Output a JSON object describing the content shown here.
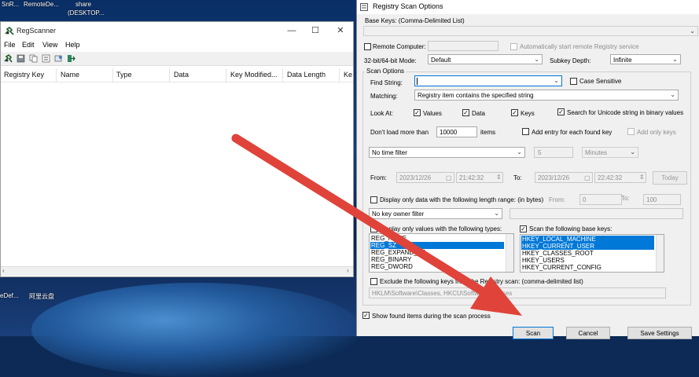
{
  "desktop": {
    "top_labels": [
      "SnR...",
      "RemoteDe...",
      "share",
      "(DESKTOP..."
    ],
    "bottom_labels": [
      "eDef...",
      "阿里云盘"
    ]
  },
  "regscanner": {
    "title": "RegScanner",
    "menu": [
      "File",
      "Edit",
      "View",
      "Help"
    ],
    "columns": [
      "Registry Key",
      "Name",
      "Type",
      "Data",
      "Key Modified...",
      "Data Length",
      "Ke"
    ],
    "toolbar_icons": [
      "regscanner-icon",
      "save-icon",
      "copy-icon",
      "properties-icon",
      "refresh-icon",
      "exit-icon"
    ]
  },
  "dialog": {
    "title": "Registry Scan Options",
    "base_keys_label": "Base Keys:  (Comma-Delimited List)",
    "base_keys_value": "",
    "remote_computer_label": "Remote Computer:",
    "remote_computer_value": "",
    "auto_start_label": "Automatically start remote Registry service",
    "mode_label": "32-bit/64-bit Mode:",
    "mode_value": "Default",
    "subkey_depth_label": "Subkey Depth:",
    "subkey_depth_value": "Infinite",
    "scan_options_label": "Scan Options",
    "find_string_label": "Find String:",
    "find_string_value": "",
    "case_sensitive_label": "Case Sensitive",
    "matching_label": "Matching:",
    "matching_value": "Registry item contains the specified string",
    "look_at_label": "Look At:",
    "values_label": "Values",
    "data_label": "Data",
    "keys_label": "Keys",
    "unicode_label": "Search for Unicode string in binary values",
    "dont_load_label": "Don't load more than",
    "dont_load_value": "10000",
    "items_label": "items",
    "add_entry_label": "Add entry for each found key",
    "add_only_keys_label": "Add only keys",
    "time_filter_value": "No time filter",
    "time_amount_value": "5",
    "time_unit_value": "Minutes",
    "from_label": "From:",
    "from_date": "2023/12/26",
    "from_time": "21:42:32",
    "to_label": "To:",
    "to_date": "2023/12/26",
    "to_time": "22:42:32",
    "today_label": "Today",
    "length_range_label": "Display only data with the following length range: (in bytes)",
    "length_from_label": "From:",
    "length_from_value": "0",
    "length_to_label": "To:",
    "length_to_value": "100",
    "owner_filter_value": "No key owner filter",
    "value_types_label": "Display only values with the following types:",
    "value_types": [
      "REG_NONE",
      "REG_SZ",
      "REG_EXPAND_SZ",
      "REG_BINARY",
      "REG_DWORD"
    ],
    "scan_base_keys_label": "Scan the following base keys:",
    "base_key_list": [
      "HKEY_LOCAL_MACHINE",
      "HKEY_CURRENT_USER",
      "HKEY_CLASSES_ROOT",
      "HKEY_USERS",
      "HKEY_CURRENT_CONFIG"
    ],
    "exclude_label": "Exclude the following keys from the Registry scan: (comma-delimited list)",
    "exclude_value": "HKLM\\Software\\Classes, HKCU\\Software\\Classes",
    "show_found_label": "Show found items during the scan process",
    "scan_button": "Scan",
    "cancel_button": "Cancel",
    "save_settings_button": "Save Settings"
  },
  "colors": {
    "selection": "#0078d7",
    "annotation_arrow": "#e0433a"
  }
}
